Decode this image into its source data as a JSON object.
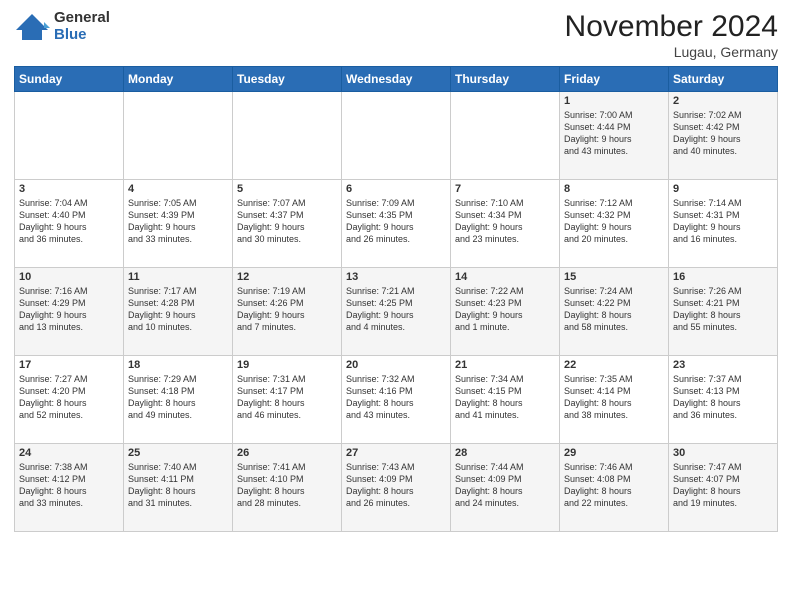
{
  "header": {
    "logo_general": "General",
    "logo_blue": "Blue",
    "month_title": "November 2024",
    "location": "Lugau, Germany"
  },
  "weekdays": [
    "Sunday",
    "Monday",
    "Tuesday",
    "Wednesday",
    "Thursday",
    "Friday",
    "Saturday"
  ],
  "rows": [
    [
      {
        "day": "",
        "info": ""
      },
      {
        "day": "",
        "info": ""
      },
      {
        "day": "",
        "info": ""
      },
      {
        "day": "",
        "info": ""
      },
      {
        "day": "",
        "info": ""
      },
      {
        "day": "1",
        "info": "Sunrise: 7:00 AM\nSunset: 4:44 PM\nDaylight: 9 hours\nand 43 minutes."
      },
      {
        "day": "2",
        "info": "Sunrise: 7:02 AM\nSunset: 4:42 PM\nDaylight: 9 hours\nand 40 minutes."
      }
    ],
    [
      {
        "day": "3",
        "info": "Sunrise: 7:04 AM\nSunset: 4:40 PM\nDaylight: 9 hours\nand 36 minutes."
      },
      {
        "day": "4",
        "info": "Sunrise: 7:05 AM\nSunset: 4:39 PM\nDaylight: 9 hours\nand 33 minutes."
      },
      {
        "day": "5",
        "info": "Sunrise: 7:07 AM\nSunset: 4:37 PM\nDaylight: 9 hours\nand 30 minutes."
      },
      {
        "day": "6",
        "info": "Sunrise: 7:09 AM\nSunset: 4:35 PM\nDaylight: 9 hours\nand 26 minutes."
      },
      {
        "day": "7",
        "info": "Sunrise: 7:10 AM\nSunset: 4:34 PM\nDaylight: 9 hours\nand 23 minutes."
      },
      {
        "day": "8",
        "info": "Sunrise: 7:12 AM\nSunset: 4:32 PM\nDaylight: 9 hours\nand 20 minutes."
      },
      {
        "day": "9",
        "info": "Sunrise: 7:14 AM\nSunset: 4:31 PM\nDaylight: 9 hours\nand 16 minutes."
      }
    ],
    [
      {
        "day": "10",
        "info": "Sunrise: 7:16 AM\nSunset: 4:29 PM\nDaylight: 9 hours\nand 13 minutes."
      },
      {
        "day": "11",
        "info": "Sunrise: 7:17 AM\nSunset: 4:28 PM\nDaylight: 9 hours\nand 10 minutes."
      },
      {
        "day": "12",
        "info": "Sunrise: 7:19 AM\nSunset: 4:26 PM\nDaylight: 9 hours\nand 7 minutes."
      },
      {
        "day": "13",
        "info": "Sunrise: 7:21 AM\nSunset: 4:25 PM\nDaylight: 9 hours\nand 4 minutes."
      },
      {
        "day": "14",
        "info": "Sunrise: 7:22 AM\nSunset: 4:23 PM\nDaylight: 9 hours\nand 1 minute."
      },
      {
        "day": "15",
        "info": "Sunrise: 7:24 AM\nSunset: 4:22 PM\nDaylight: 8 hours\nand 58 minutes."
      },
      {
        "day": "16",
        "info": "Sunrise: 7:26 AM\nSunset: 4:21 PM\nDaylight: 8 hours\nand 55 minutes."
      }
    ],
    [
      {
        "day": "17",
        "info": "Sunrise: 7:27 AM\nSunset: 4:20 PM\nDaylight: 8 hours\nand 52 minutes."
      },
      {
        "day": "18",
        "info": "Sunrise: 7:29 AM\nSunset: 4:18 PM\nDaylight: 8 hours\nand 49 minutes."
      },
      {
        "day": "19",
        "info": "Sunrise: 7:31 AM\nSunset: 4:17 PM\nDaylight: 8 hours\nand 46 minutes."
      },
      {
        "day": "20",
        "info": "Sunrise: 7:32 AM\nSunset: 4:16 PM\nDaylight: 8 hours\nand 43 minutes."
      },
      {
        "day": "21",
        "info": "Sunrise: 7:34 AM\nSunset: 4:15 PM\nDaylight: 8 hours\nand 41 minutes."
      },
      {
        "day": "22",
        "info": "Sunrise: 7:35 AM\nSunset: 4:14 PM\nDaylight: 8 hours\nand 38 minutes."
      },
      {
        "day": "23",
        "info": "Sunrise: 7:37 AM\nSunset: 4:13 PM\nDaylight: 8 hours\nand 36 minutes."
      }
    ],
    [
      {
        "day": "24",
        "info": "Sunrise: 7:38 AM\nSunset: 4:12 PM\nDaylight: 8 hours\nand 33 minutes."
      },
      {
        "day": "25",
        "info": "Sunrise: 7:40 AM\nSunset: 4:11 PM\nDaylight: 8 hours\nand 31 minutes."
      },
      {
        "day": "26",
        "info": "Sunrise: 7:41 AM\nSunset: 4:10 PM\nDaylight: 8 hours\nand 28 minutes."
      },
      {
        "day": "27",
        "info": "Sunrise: 7:43 AM\nSunset: 4:09 PM\nDaylight: 8 hours\nand 26 minutes."
      },
      {
        "day": "28",
        "info": "Sunrise: 7:44 AM\nSunset: 4:09 PM\nDaylight: 8 hours\nand 24 minutes."
      },
      {
        "day": "29",
        "info": "Sunrise: 7:46 AM\nSunset: 4:08 PM\nDaylight: 8 hours\nand 22 minutes."
      },
      {
        "day": "30",
        "info": "Sunrise: 7:47 AM\nSunset: 4:07 PM\nDaylight: 8 hours\nand 19 minutes."
      }
    ]
  ]
}
